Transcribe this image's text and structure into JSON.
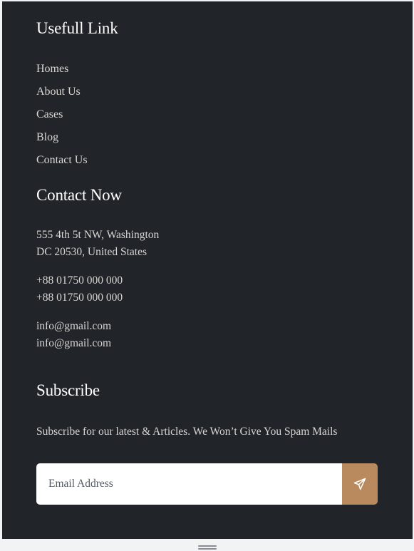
{
  "useful_links": {
    "heading": "Usefull Link",
    "items": [
      "Homes",
      "About Us",
      "Cases",
      "Blog",
      "Contact Us"
    ]
  },
  "contact": {
    "heading": "Contact Now",
    "address": [
      "555 4th 5t NW, Washington",
      "DC 20530, United States"
    ],
    "phones": [
      "+88 01750 000 000",
      "+88 01750 000 000"
    ],
    "emails": [
      "info@gmail.com",
      "info@gmail.com"
    ]
  },
  "subscribe": {
    "heading": "Subscribe",
    "text": "Subscribe for our latest & Articles. We Won’t Give You Spam Mails",
    "placeholder": "Email Address",
    "send_icon": "paper-plane-icon"
  },
  "colors": {
    "footer_bg": "#212429",
    "accent": "#b88a5d",
    "text": "#d8d6d2",
    "heading": "#ffffff"
  }
}
